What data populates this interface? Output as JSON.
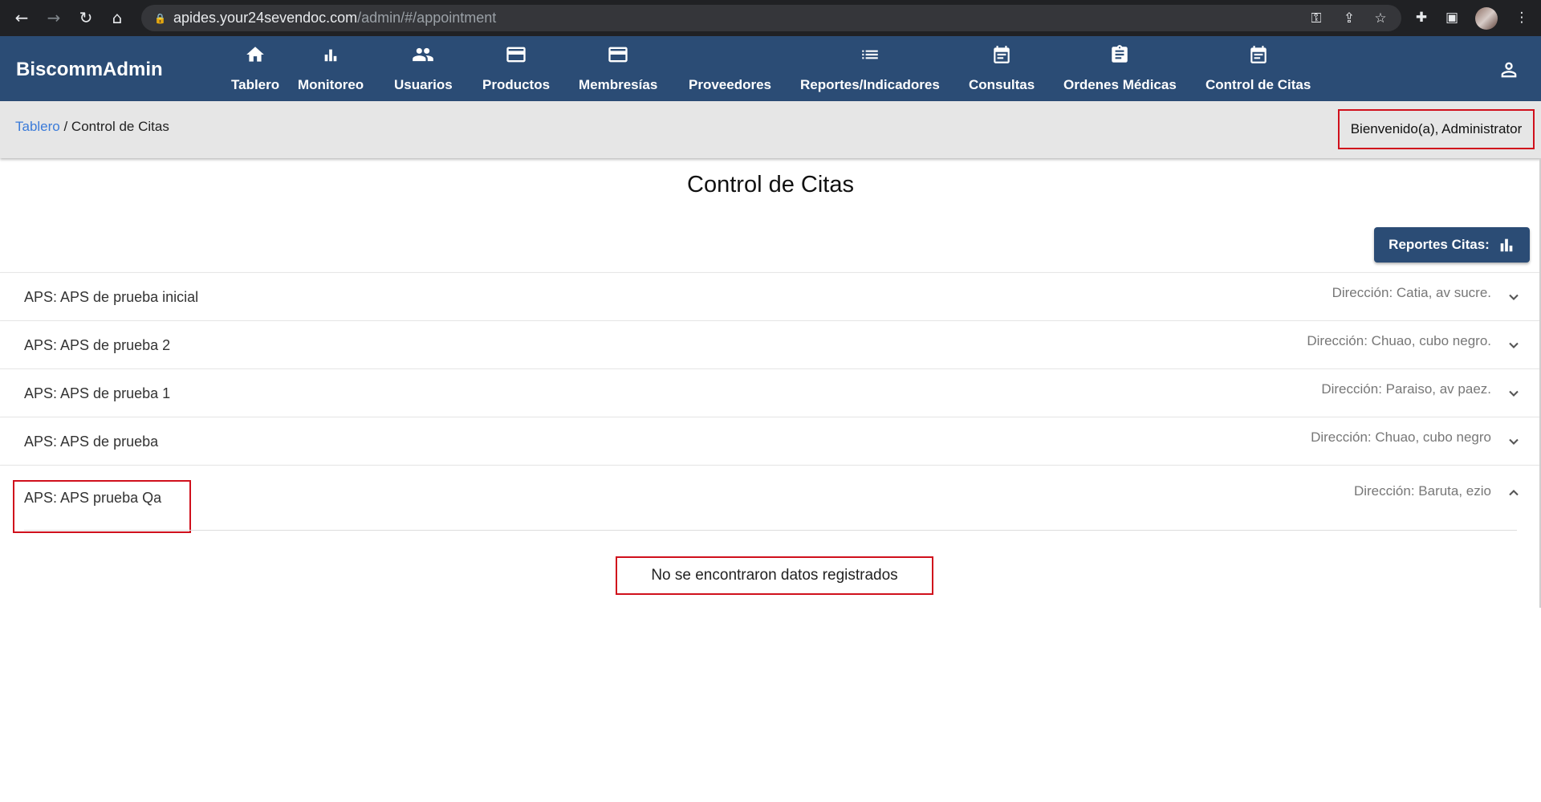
{
  "browser": {
    "url_domain": "apides.your24sevendoc.com",
    "url_path": "/admin/#/appointment"
  },
  "app": {
    "brand": "BiscommAdmin",
    "nav": [
      {
        "label": "Tablero",
        "icon": "home-icon"
      },
      {
        "label": "Monitoreo",
        "icon": "bar-chart-icon"
      },
      {
        "label": "Usuarios",
        "icon": "people-icon"
      },
      {
        "label": "Productos",
        "icon": "credit-card-icon"
      },
      {
        "label": "Membresías",
        "icon": "credit-card-icon"
      },
      {
        "label": "Proveedores",
        "icon": ""
      },
      {
        "label": "Reportes/Indicadores",
        "icon": "list-icon"
      },
      {
        "label": "Consultas",
        "icon": "calendar-icon"
      },
      {
        "label": "Ordenes Médicas",
        "icon": "clipboard-icon"
      },
      {
        "label": "Control de Citas",
        "icon": "calendar-icon"
      }
    ],
    "user_icon": "account-icon"
  },
  "breadcrumb": {
    "link": "Tablero",
    "current": " / Control de Citas"
  },
  "welcome": "Bienvenido(a), Administrator",
  "page_title": "Control de Citas",
  "report_button": {
    "label": "Reportes Citas:",
    "icon": "bar-chart-icon"
  },
  "panels": [
    {
      "name": "APS: APS de prueba inicial",
      "address": "Dirección: Catia, av sucre.",
      "expanded": false
    },
    {
      "name": "APS: APS de prueba 2",
      "address": "Dirección: Chuao, cubo negro.",
      "expanded": false
    },
    {
      "name": "APS: APS de prueba 1",
      "address": "Dirección: Paraiso, av paez.",
      "expanded": false
    },
    {
      "name": "APS: APS de prueba",
      "address": "Dirección: Chuao, cubo negro",
      "expanded": false
    },
    {
      "name": "APS: APS prueba Qa",
      "address": "Dirección: Baruta, ezio",
      "expanded": true
    }
  ],
  "empty_message": "No se encontraron datos registrados",
  "colors": {
    "appbar": "#2b4c75",
    "link": "#3b7bd9",
    "highlight_border": "#d0101c",
    "crumbbar": "#e6e6e6"
  }
}
